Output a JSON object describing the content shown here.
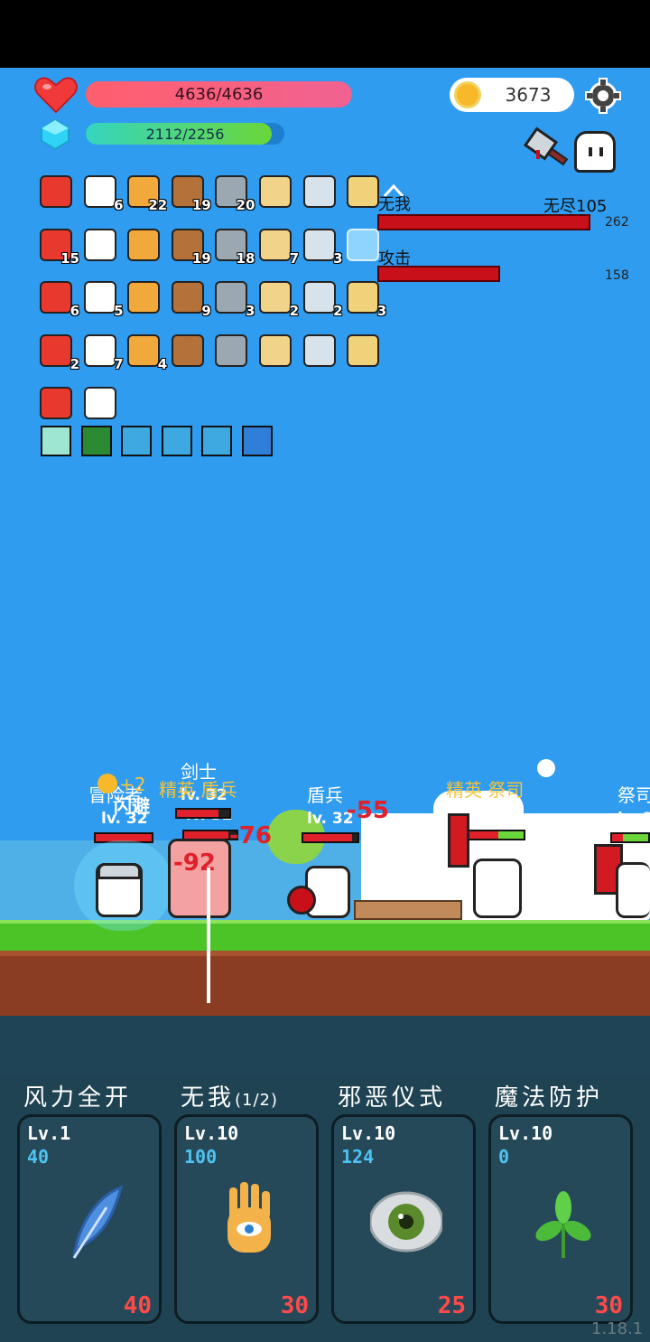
{
  "player": {
    "hp": "4636/4636",
    "mp": "2112/2256",
    "mp_fraction": 0.936,
    "gold": "3673"
  },
  "items": [
    {
      "icon": "magnet-icon",
      "count": ""
    },
    {
      "icon": "envelope-icon",
      "count": "6"
    },
    {
      "icon": "book-icon",
      "count": "22"
    },
    {
      "icon": "shield-icon",
      "count": "19"
    },
    {
      "icon": "sword-icon",
      "count": "20"
    },
    {
      "icon": "scroll-icon",
      "count": ""
    },
    {
      "icon": "broadsword-icon",
      "count": ""
    },
    {
      "icon": "treasure-map-icon",
      "count": ""
    },
    {
      "icon": "apple-icon",
      "count": "15"
    },
    {
      "icon": "shirt-icon",
      "count": ""
    },
    {
      "icon": "viking-helmet-icon",
      "count": ""
    },
    {
      "icon": "flower-icon",
      "count": "19"
    },
    {
      "icon": "watermelon-icon",
      "count": "18"
    },
    {
      "icon": "ice-cream-icon",
      "count": "7"
    },
    {
      "icon": "bookmark-icon",
      "count": "3"
    },
    {
      "icon": "empty-slot-icon",
      "count": ""
    },
    {
      "icon": "battery-icon",
      "count": "6"
    },
    {
      "icon": "spiked-ball-icon",
      "count": "5"
    },
    {
      "icon": "skull-book-icon",
      "count": ""
    },
    {
      "icon": "tombstone-icon",
      "count": "9"
    },
    {
      "icon": "syringe-icon",
      "count": "3"
    },
    {
      "icon": "durian-icon",
      "count": "2"
    },
    {
      "icon": "playing-card-icon",
      "count": "2"
    },
    {
      "icon": "sock-icon",
      "count": "3"
    },
    {
      "icon": "dice-icon",
      "count": "2"
    },
    {
      "icon": "strawberry-icon",
      "count": "7"
    },
    {
      "icon": "coconut-icon",
      "count": "4"
    },
    {
      "icon": "map-icon",
      "count": ""
    },
    {
      "icon": "pill-icon",
      "count": ""
    },
    {
      "icon": "cauldron-icon",
      "count": ""
    },
    {
      "icon": "potion-icon",
      "count": ""
    },
    {
      "icon": "ghost-icon",
      "count": ""
    },
    {
      "icon": "molecule-icon",
      "count": ""
    },
    {
      "icon": "ruby-icon",
      "count": ""
    }
  ],
  "buffs": [
    "light-burst-icon",
    "poison-icon",
    "spiral-icon",
    "spiral-icon",
    "spiral-icon",
    "lightning-icon"
  ],
  "enemy_panel": {
    "row1_label": "无我",
    "row1_right": "无尽105",
    "row1_value": "262",
    "row2_label": "攻击",
    "row2_value": "158"
  },
  "battle": {
    "units": [
      {
        "name": "冒险者",
        "lv": "lv. 32"
      },
      {
        "name": "剑士",
        "lv": "lv. 32"
      },
      {
        "name": "精英 盾兵",
        "lv": "lv. 32"
      },
      {
        "name": "盾兵",
        "lv": "lv. 32"
      },
      {
        "name": "精英 祭司",
        "lv": ""
      },
      {
        "name": "祭司",
        "lv": "lv. 3"
      }
    ],
    "popups": {
      "dodge": "闪避",
      "coin": "+2",
      "dmg1": "-76",
      "dmg2": "-92",
      "dmg3": "-55"
    }
  },
  "skills": [
    {
      "name": "风力全开",
      "suffix": "",
      "lv": "Lv.1",
      "value": "40",
      "cost": "40",
      "icon": "feather-icon"
    },
    {
      "name": "无我",
      "suffix": "(1/2)",
      "lv": "Lv.10",
      "value": "100",
      "cost": "30",
      "icon": "eye-hand-icon"
    },
    {
      "name": "邪恶仪式",
      "suffix": "",
      "lv": "Lv.10",
      "value": "124",
      "cost": "25",
      "icon": "eye-icon"
    },
    {
      "name": "魔法防护",
      "suffix": "",
      "lv": "Lv.10",
      "value": "0",
      "cost": "30",
      "icon": "sprout-icon"
    }
  ],
  "version": "1.18.1",
  "colors": {
    "sky": "#2f9cf0",
    "hp": "#ff5f6d",
    "mp": "#6bd63a",
    "damage": "#e0202a",
    "cost": "#ff4a4a",
    "level_value": "#4ec3f0"
  }
}
